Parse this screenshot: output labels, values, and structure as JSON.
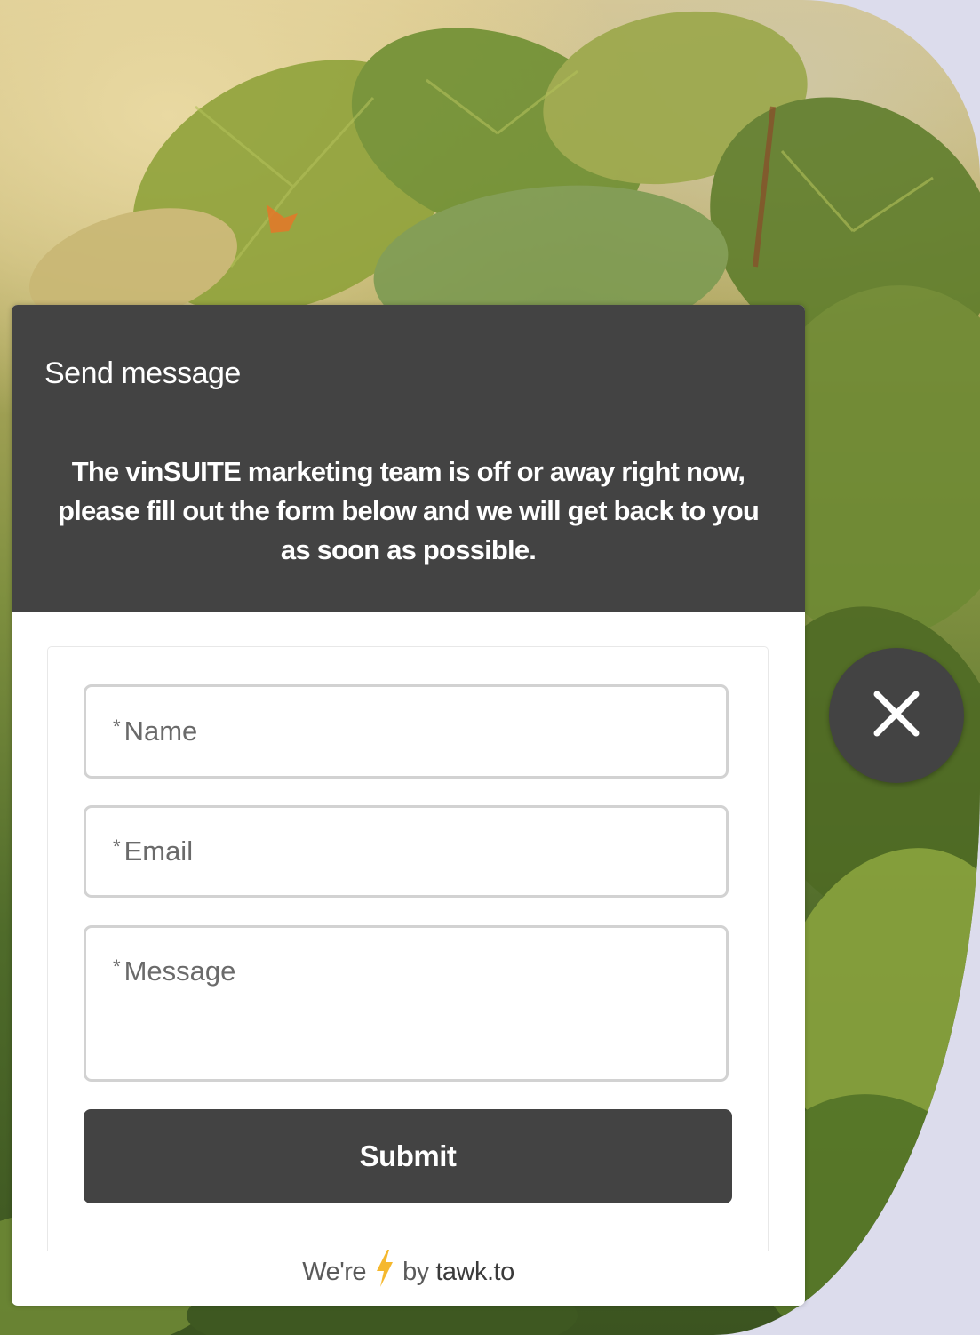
{
  "widget": {
    "title": "Send message",
    "description": "The vinSUITE marketing  team is off or away right now, please fill out the form below and we will get back to you as soon as possible."
  },
  "form": {
    "required_marker": "*",
    "name_label": "Name",
    "email_label": "Email",
    "message_label": "Message",
    "submit_label": "Submit"
  },
  "footer": {
    "prefix": "We're",
    "by": "by",
    "brand": "tawk.to"
  },
  "icons": {
    "close": "close-icon",
    "bolt": "lightning-bolt-icon"
  },
  "colors": {
    "header_bg": "#434343",
    "button_bg": "#434343",
    "bolt": "#f5b82e",
    "page_bg": "#dcdcec"
  }
}
